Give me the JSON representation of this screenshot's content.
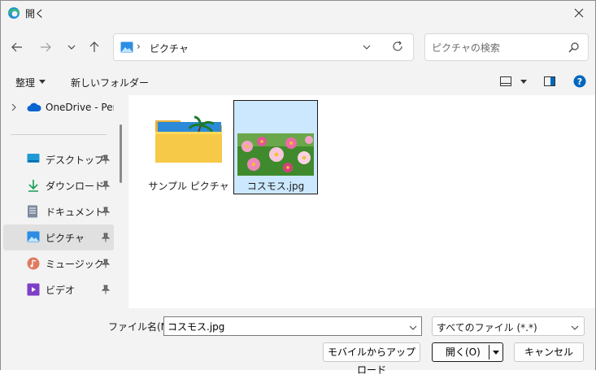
{
  "window": {
    "title": "開く"
  },
  "address": {
    "crumb": "ピクチャ",
    "separator": "›"
  },
  "search": {
    "placeholder": "ピクチャの検索"
  },
  "commandbar": {
    "organize": "整理",
    "new_folder": "新しいフォルダー"
  },
  "sidebar": {
    "items": [
      {
        "label": "OneDrive - Perso",
        "icon": "cloud-icon"
      },
      {
        "label": "デスクトップ",
        "icon": "desktop-icon",
        "pinned": true
      },
      {
        "label": "ダウンロード",
        "icon": "download-icon",
        "pinned": true
      },
      {
        "label": "ドキュメント",
        "icon": "document-icon",
        "pinned": true
      },
      {
        "label": "ピクチャ",
        "icon": "picture-icon",
        "pinned": true,
        "selected": true
      },
      {
        "label": "ミュージック",
        "icon": "music-icon",
        "pinned": true
      },
      {
        "label": "ビデオ",
        "icon": "video-icon",
        "pinned": true
      }
    ]
  },
  "files": [
    {
      "name": "サンプル ピクチャ",
      "type": "folder"
    },
    {
      "name": "コスモス.jpg",
      "type": "image",
      "selected": true
    }
  ],
  "footer": {
    "filename_label": "ファイル名(N):",
    "filename_value": "コスモス.jpg",
    "filetype": "すべてのファイル (*.*)",
    "upload_label": "モバイルからアップロード",
    "open_label": "開く(O)",
    "cancel_label": "キャンセル"
  },
  "colors": {
    "accent": "#0067c0",
    "selection": "#cce8ff",
    "window_bg": "#f3f3f3"
  }
}
